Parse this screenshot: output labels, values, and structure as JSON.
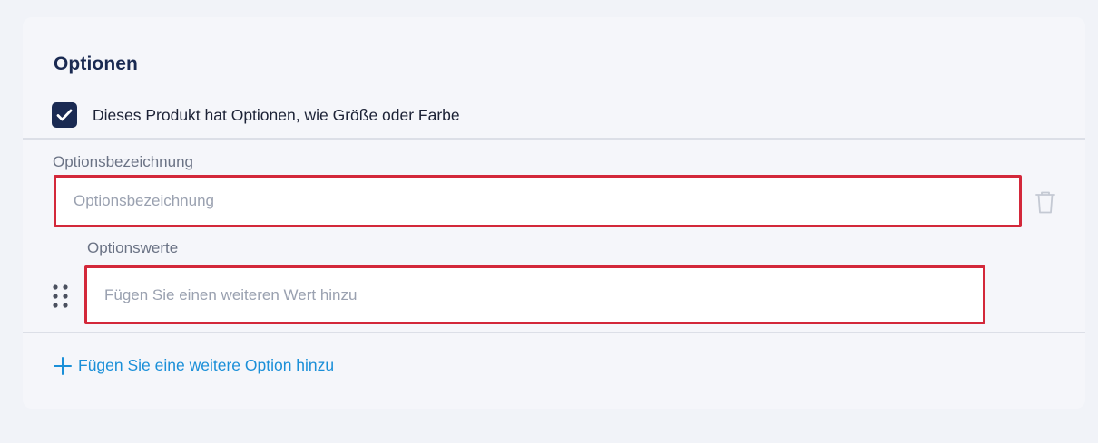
{
  "section": {
    "title": "Optionen"
  },
  "has_options": {
    "label": "Dieses Produkt hat Optionen, wie Größe oder Farbe",
    "checked": true
  },
  "option_name": {
    "label": "Optionsbezeichnung",
    "placeholder": "Optionsbezeichnung",
    "value": ""
  },
  "option_values": {
    "label": "Optionswerte",
    "placeholder": "Fügen Sie einen weiteren Wert hinzu",
    "value": ""
  },
  "add_option": {
    "label": "Fügen Sie eine weitere Option hinzu"
  },
  "icons": {
    "checkbox": "checkmark-icon",
    "delete": "trash-icon",
    "drag": "drag-handle-icon",
    "add": "plus-icon"
  },
  "colors": {
    "brand_dark": "#1a2a52",
    "link": "#1a8fd8",
    "error_border": "#d3283a"
  }
}
